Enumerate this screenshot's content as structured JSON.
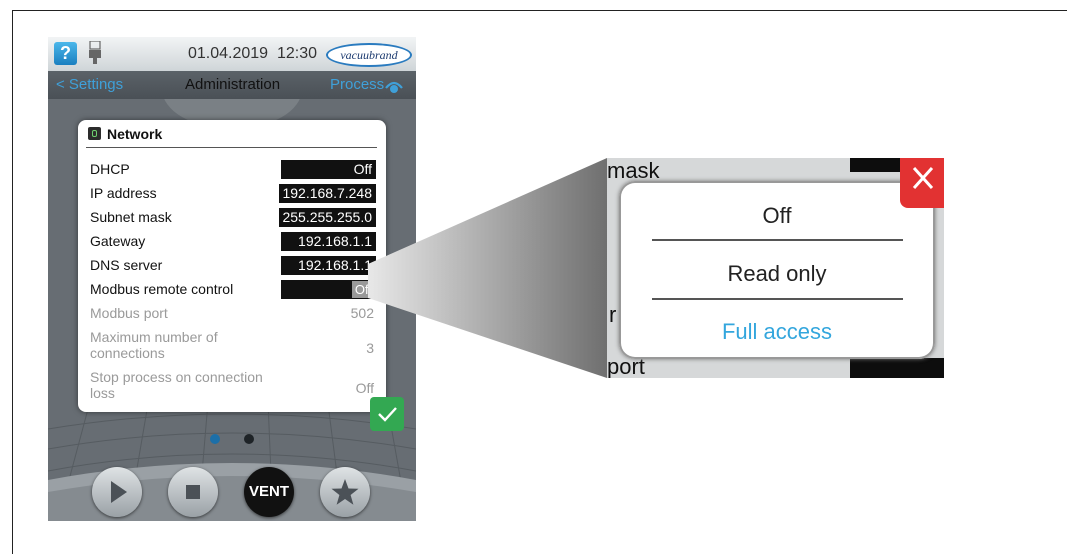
{
  "statusbar": {
    "help_label": "?",
    "date": "01.04.2019",
    "time": "12:30",
    "brand": "vacuubrand"
  },
  "navbar": {
    "back_label": "< Settings",
    "title": "Administration",
    "process_label": "Process"
  },
  "dialog": {
    "title": "Network",
    "rows": [
      {
        "label": "DHCP",
        "value": "Off"
      },
      {
        "label": "IP address",
        "value": "192.168.7.248"
      },
      {
        "label": "Subnet mask",
        "value": "255.255.255.0"
      },
      {
        "label": "Gateway",
        "value": "192.168.1.1"
      },
      {
        "label": "DNS server",
        "value": "192.168.1.1"
      },
      {
        "label": "Modbus remote control",
        "value": "Off"
      },
      {
        "label": "Modbus port",
        "value": "502"
      },
      {
        "label": "Maximum number of connections",
        "value": "3"
      },
      {
        "label": "Stop process on connection loss",
        "value": "Off"
      }
    ]
  },
  "pager": {
    "pages": 2,
    "current": 1
  },
  "bottom_buttons": {
    "vent_label": "VENT"
  },
  "zoom_popup": {
    "options": [
      "Off",
      "Read only",
      "Full access"
    ],
    "selected": "Full access",
    "background_fragments": [
      "mask",
      "r",
      "port"
    ]
  },
  "colors": {
    "accent_blue": "#33a6dd",
    "confirm_green": "#33a852",
    "close_red": "#e23232"
  }
}
